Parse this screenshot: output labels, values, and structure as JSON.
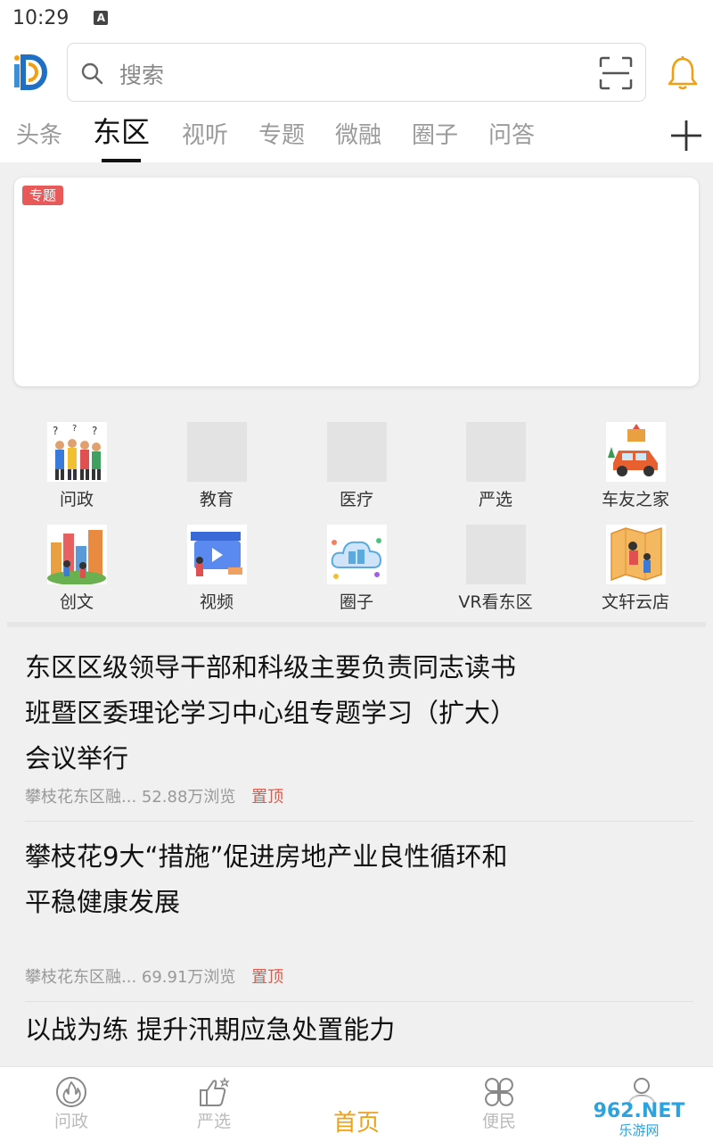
{
  "status_bar": {
    "time": "10:29",
    "notification": "A"
  },
  "search": {
    "placeholder": "搜索"
  },
  "tabs": [
    {
      "label": "头条"
    },
    {
      "label": "东区",
      "active": true
    },
    {
      "label": "视听"
    },
    {
      "label": "专题"
    },
    {
      "label": "微融"
    },
    {
      "label": "圈子"
    },
    {
      "label": "问答"
    }
  ],
  "banner": {
    "tag": "专题"
  },
  "grid": [
    {
      "label": "问政",
      "icon": "people-question-icon"
    },
    {
      "label": "教育",
      "icon": "placeholder"
    },
    {
      "label": "医疗",
      "icon": "placeholder"
    },
    {
      "label": "严选",
      "icon": "placeholder"
    },
    {
      "label": "车友之家",
      "icon": "car-icon"
    },
    {
      "label": "创文",
      "icon": "city-icon"
    },
    {
      "label": "视频",
      "icon": "video-icon"
    },
    {
      "label": "圈子",
      "icon": "cloud-icon"
    },
    {
      "label": "VR看东区",
      "icon": "placeholder"
    },
    {
      "label": "文轩云店",
      "icon": "map-people-icon"
    }
  ],
  "news": [
    {
      "title": "东区区级领导干部和科级主要负责同志读书班暨区委理论学习中心组专题学习（扩大）会议举行",
      "source": "攀枝花东区融...",
      "views": "52.88万浏览",
      "pin": "置顶"
    },
    {
      "title": "攀枝花9大“措施”促进房地产业良性循环和平稳健康发展",
      "source": "攀枝花东区融...",
      "views": "69.91万浏览",
      "pin": "置顶"
    },
    {
      "title": "以战为练 提升汛期应急处置能力"
    }
  ],
  "bottom_nav": [
    {
      "label": "问政",
      "icon": "fire-icon"
    },
    {
      "label": "严选",
      "icon": "thumbs-up-icon"
    },
    {
      "label": "首页",
      "active": true
    },
    {
      "label": "便民",
      "icon": "clover-icon"
    },
    {
      "label": "",
      "icon": "user-icon"
    }
  ],
  "watermark": {
    "text_top": "962.NET",
    "text_bottom": "乐游网"
  },
  "colors": {
    "accent": "#f0a012",
    "tag_red": "#e85a5a",
    "pin_red": "#e05a4a"
  }
}
